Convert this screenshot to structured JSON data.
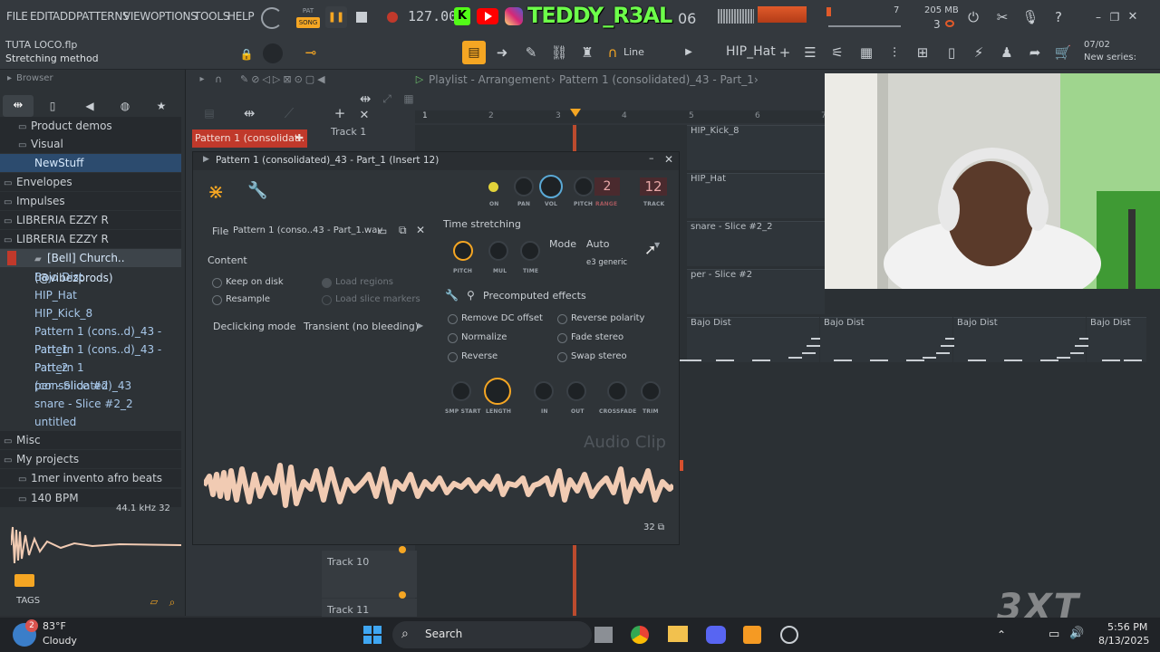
{
  "menubar": {
    "items": [
      "FILE",
      "EDIT",
      "ADD",
      "PATTERNS",
      "VIEW",
      "OPTIONS",
      "TOOLS",
      "HELP"
    ],
    "pat_label": "PAT",
    "song_label": "SONG",
    "tempo": "127.000",
    "time_display": "06",
    "overlay_name": "TEDDY_R3AL",
    "memory": "205 MB",
    "cpu_count": "3",
    "project_file": "TUTA LOCO.flp",
    "hint": "Stretching method"
  },
  "toolbar": {
    "snap": "Line",
    "pattern_selector": "HIP_Hat",
    "date": "07/02",
    "news": "New series:"
  },
  "browser": {
    "title": "Browser",
    "items": [
      {
        "label": "Product demos",
        "type": "folder-sub"
      },
      {
        "label": "Visual",
        "type": "folder-sub"
      },
      {
        "label": "NewStuff",
        "type": "file-selected"
      },
      {
        "label": "Envelopes",
        "type": "folder"
      },
      {
        "label": "Impulses",
        "type": "folder"
      },
      {
        "label": "LIBRERIA EZZY R",
        "type": "folder"
      },
      {
        "label": "LIBRERIA EZZY R",
        "type": "folder"
      },
      {
        "label": "[Bell] Church..(@vibezprods)",
        "type": "file-highlight"
      },
      {
        "label": "Bajo Dist",
        "type": "file"
      },
      {
        "label": "HIP_Hat",
        "type": "file"
      },
      {
        "label": "HIP_Kick_8",
        "type": "file"
      },
      {
        "label": "Pattern 1 (cons..d)_43 - Part_1",
        "type": "file"
      },
      {
        "label": "Pattern 1 (cons..d)_43 - Part_2",
        "type": "file"
      },
      {
        "label": "Pattern 1 (consolidated)_43",
        "type": "file"
      },
      {
        "label": "per - Slice #2",
        "type": "file"
      },
      {
        "label": "snare - Slice #2_2",
        "type": "file"
      },
      {
        "label": "untitled",
        "type": "file"
      },
      {
        "label": "Misc",
        "type": "folder"
      },
      {
        "label": "My projects",
        "type": "folder"
      },
      {
        "label": "1mer invento afro beats",
        "type": "folder-sub"
      },
      {
        "label": "140 BPM",
        "type": "folder-sub"
      }
    ],
    "sample_info": "44.1 kHz 32",
    "tags_label": "TAGS"
  },
  "playlist": {
    "title": "Playlist - Arrangement",
    "pattern_crumb": "Pattern 1 (consolidated)_43 - Part_1",
    "pattern_tab": "Pattern 1 (consolidat..",
    "ruler": [
      "1",
      "2",
      "3",
      "4",
      "5",
      "6",
      "7"
    ],
    "tracks": [
      "Track 1",
      "Track 10",
      "Track 11"
    ],
    "clips": [
      "HIP_Kick_8",
      "HIP_Hat",
      "snare - Slice #2_2",
      "per - Slice #2",
      "Bajo Dist",
      "Bajo Dist",
      "Bajo Dist",
      "Bajo Dist"
    ]
  },
  "clipwin": {
    "title": "Pattern 1 (consolidated)_43 - Part_1 (Insert 12)",
    "knobs": [
      "ON",
      "PAN",
      "VOL",
      "PITCH",
      "RANGE",
      "TRACK"
    ],
    "range_value": "2",
    "track_value": "12",
    "file_label": "File",
    "file_name": "Pattern 1 (conso..43 - Part_1.wav",
    "content_label": "Content",
    "keep_on_disk": "Keep on disk",
    "resample": "Resample",
    "load_regions": "Load regions",
    "load_slice_markers": "Load slice markers",
    "declick_label": "Declicking mode",
    "declick_value": "Transient (no bleeding)",
    "time_stretching": "Time stretching",
    "ts_knobs": [
      "PITCH",
      "MUL",
      "TIME"
    ],
    "mode_label": "Mode",
    "mode_value": "Auto",
    "mode_sub": "e3 generic",
    "precomputed": "Precomputed effects",
    "effects_left": [
      "Remove DC offset",
      "Normalize",
      "Reverse"
    ],
    "effects_right": [
      "Reverse polarity",
      "Fade stereo",
      "Swap stereo"
    ],
    "bottom_knobs": [
      "SMP START",
      "LENGTH",
      "IN",
      "OUT",
      "CROSSFADE",
      "TRIM"
    ],
    "watermark": "Audio Clip",
    "bit_depth": "32"
  },
  "taskbar": {
    "weather_temp": "83°F",
    "weather_desc": "Cloudy",
    "weather_badge": "2",
    "search": "Search",
    "time": "5:56 PM",
    "date": "8/13/2025"
  },
  "watermark": "3XT",
  "colors": {
    "accent_orange": "#f5a623",
    "pattern_tab": "#c0392b",
    "waveform": "#f1cbb3",
    "track_number": "#c2404a"
  }
}
